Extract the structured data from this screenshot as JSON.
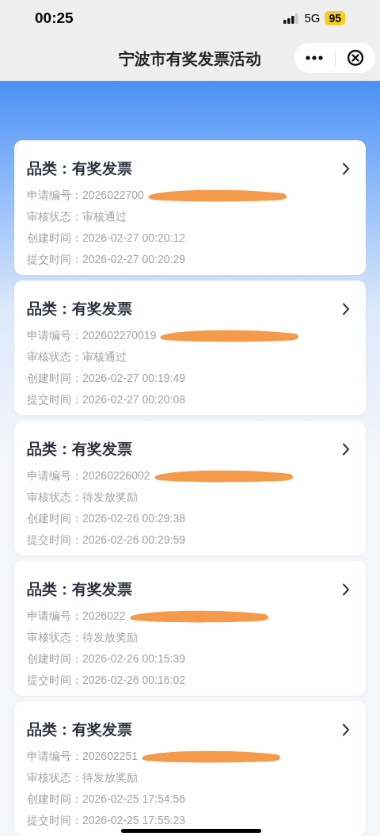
{
  "status_bar": {
    "time": "00:25",
    "network": "5G",
    "battery": "95"
  },
  "nav_bar": {
    "title": "宁波市有奖发票活动"
  },
  "records": [
    {
      "title": "品类：有奖发票",
      "fields": [
        {
          "text": "申请编号：2026022700",
          "redacted": true
        },
        {
          "text": "审核状态：审核通过",
          "redacted": false
        },
        {
          "text": "创建时间：2026-02-27 00:20:12",
          "redacted": false
        },
        {
          "text": "提交时间：2026-02-27 00:20:29",
          "redacted": false
        }
      ]
    },
    {
      "title": "品类：有奖发票",
      "fields": [
        {
          "text": "申请编号：202602270019",
          "redacted": true
        },
        {
          "text": "审核状态：审核通过",
          "redacted": false
        },
        {
          "text": "创建时间：2026-02-27 00:19:49",
          "redacted": false
        },
        {
          "text": "提交时间：2026-02-27 00:20:08",
          "redacted": false
        }
      ]
    },
    {
      "title": "品类：有奖发票",
      "fields": [
        {
          "text": "申请编号：20260226002",
          "redacted": true
        },
        {
          "text": "审核状态：待发放奖励",
          "redacted": false
        },
        {
          "text": "创建时间：2026-02-26 00:29:38",
          "redacted": false
        },
        {
          "text": "提交时间：2026-02-26 00:29:59",
          "redacted": false
        }
      ]
    },
    {
      "title": "品类：有奖发票",
      "fields": [
        {
          "text": "申请编号：2026022",
          "redacted": true
        },
        {
          "text": "审核状态：待发放奖励",
          "redacted": false
        },
        {
          "text": "创建时间：2026-02-26 00:15:39",
          "redacted": false
        },
        {
          "text": "提交时间：2026-02-26 00:16:02",
          "redacted": false
        }
      ]
    },
    {
      "title": "品类：有奖发票",
      "fields": [
        {
          "text": "申请编号：202602251",
          "redacted": true
        },
        {
          "text": "审核状态：待发放奖励",
          "redacted": false
        },
        {
          "text": "创建时间：2026-02-25 17:54:56",
          "redacted": false
        },
        {
          "text": "提交时间：2026-02-25 17:55:23",
          "redacted": false
        }
      ]
    }
  ]
}
